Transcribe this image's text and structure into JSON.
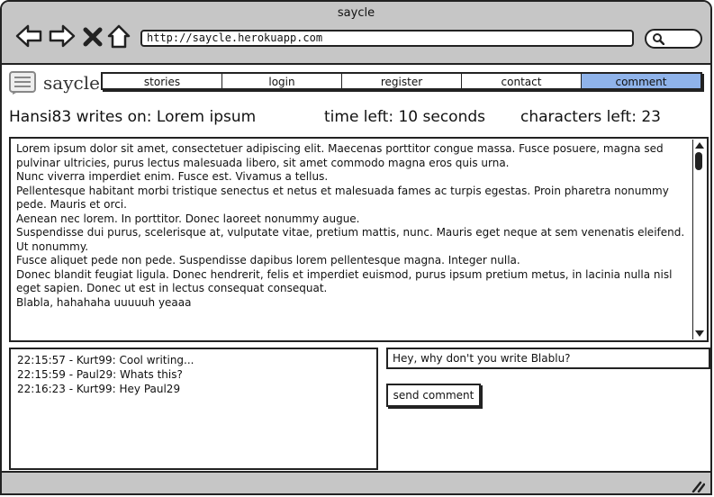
{
  "window": {
    "title": "saycle"
  },
  "toolbar": {
    "back_icon": "back-arrow-icon",
    "forward_icon": "forward-arrow-icon",
    "stop_icon": "close-icon",
    "home_icon": "home-icon",
    "url": "http://saycle.herokuapp.com",
    "search_icon": "search-icon"
  },
  "brand": {
    "name": "saycle",
    "icon": "document-lines-icon"
  },
  "nav": {
    "tabs": [
      {
        "label": "stories",
        "active": false
      },
      {
        "label": "login",
        "active": false
      },
      {
        "label": "register",
        "active": false
      },
      {
        "label": "contact",
        "active": false
      },
      {
        "label": "comment",
        "active": true
      }
    ],
    "active_color": "#8fb3ea"
  },
  "status": {
    "author_line": "Hansi83 writes on: Lorem ipsum",
    "time_left": "time left: 10 seconds",
    "characters_left": "characters left: 23"
  },
  "story": {
    "lines": [
      "Lorem ipsum dolor sit amet, consectetuer adipiscing elit. Maecenas porttitor congue massa. Fusce posuere, magna sed pulvinar ultricies, purus lectus malesuada libero, sit amet commodo magna eros quis urna.",
      "Nunc viverra imperdiet enim. Fusce est. Vivamus a tellus.",
      "Pellentesque habitant morbi tristique senectus et netus et malesuada fames ac turpis egestas. Proin pharetra nonummy pede. Mauris et orci.",
      "Aenean nec lorem. In porttitor. Donec laoreet nonummy augue.",
      "Suspendisse dui purus, scelerisque at, vulputate vitae, pretium mattis, nunc. Mauris eget neque at sem venenatis eleifend. Ut nonummy.",
      "Fusce aliquet pede non pede. Suspendisse dapibus lorem pellentesque magna. Integer nulla.",
      "Donec blandit feugiat ligula. Donec hendrerit, felis et imperdiet euismod, purus ipsum pretium metus, in lacinia nulla nisl eget sapien. Donec ut est in lectus consequat consequat.",
      "Blabla, hahahaha uuuuuh yeaaa"
    ]
  },
  "chat": {
    "messages": [
      "22:15:57 - Kurt99: Cool writing...",
      "22:15:59 - Paul29: Whats this?",
      "22:16:23 - Kurt99: Hey Paul29"
    ]
  },
  "comment": {
    "value": "Hey, why don't you write Blablu?",
    "send_label": "send comment"
  }
}
